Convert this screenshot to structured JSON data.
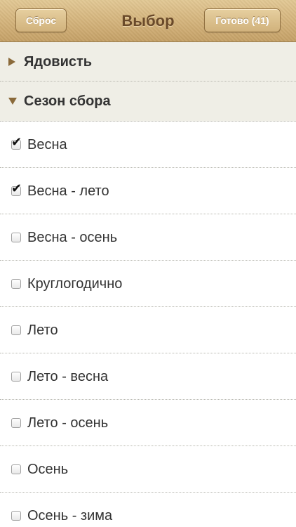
{
  "navbar": {
    "title": "Выбор",
    "reset_label": "Сброс",
    "done_label": "Готово (41)"
  },
  "sections": [
    {
      "label": "Ядовисть",
      "expanded": false
    },
    {
      "label": "Сезон сбора",
      "expanded": true
    }
  ],
  "items": [
    {
      "label": "Весна",
      "checked": true
    },
    {
      "label": "Весна - лето",
      "checked": true
    },
    {
      "label": "Весна - осень",
      "checked": false
    },
    {
      "label": "Круглогодично",
      "checked": false
    },
    {
      "label": "Лето",
      "checked": false
    },
    {
      "label": "Лето - весна",
      "checked": false
    },
    {
      "label": "Лето - осень",
      "checked": false
    },
    {
      "label": "Осень",
      "checked": false
    },
    {
      "label": "Осень - зима",
      "checked": false
    }
  ],
  "checkmark_glyph": "✔"
}
